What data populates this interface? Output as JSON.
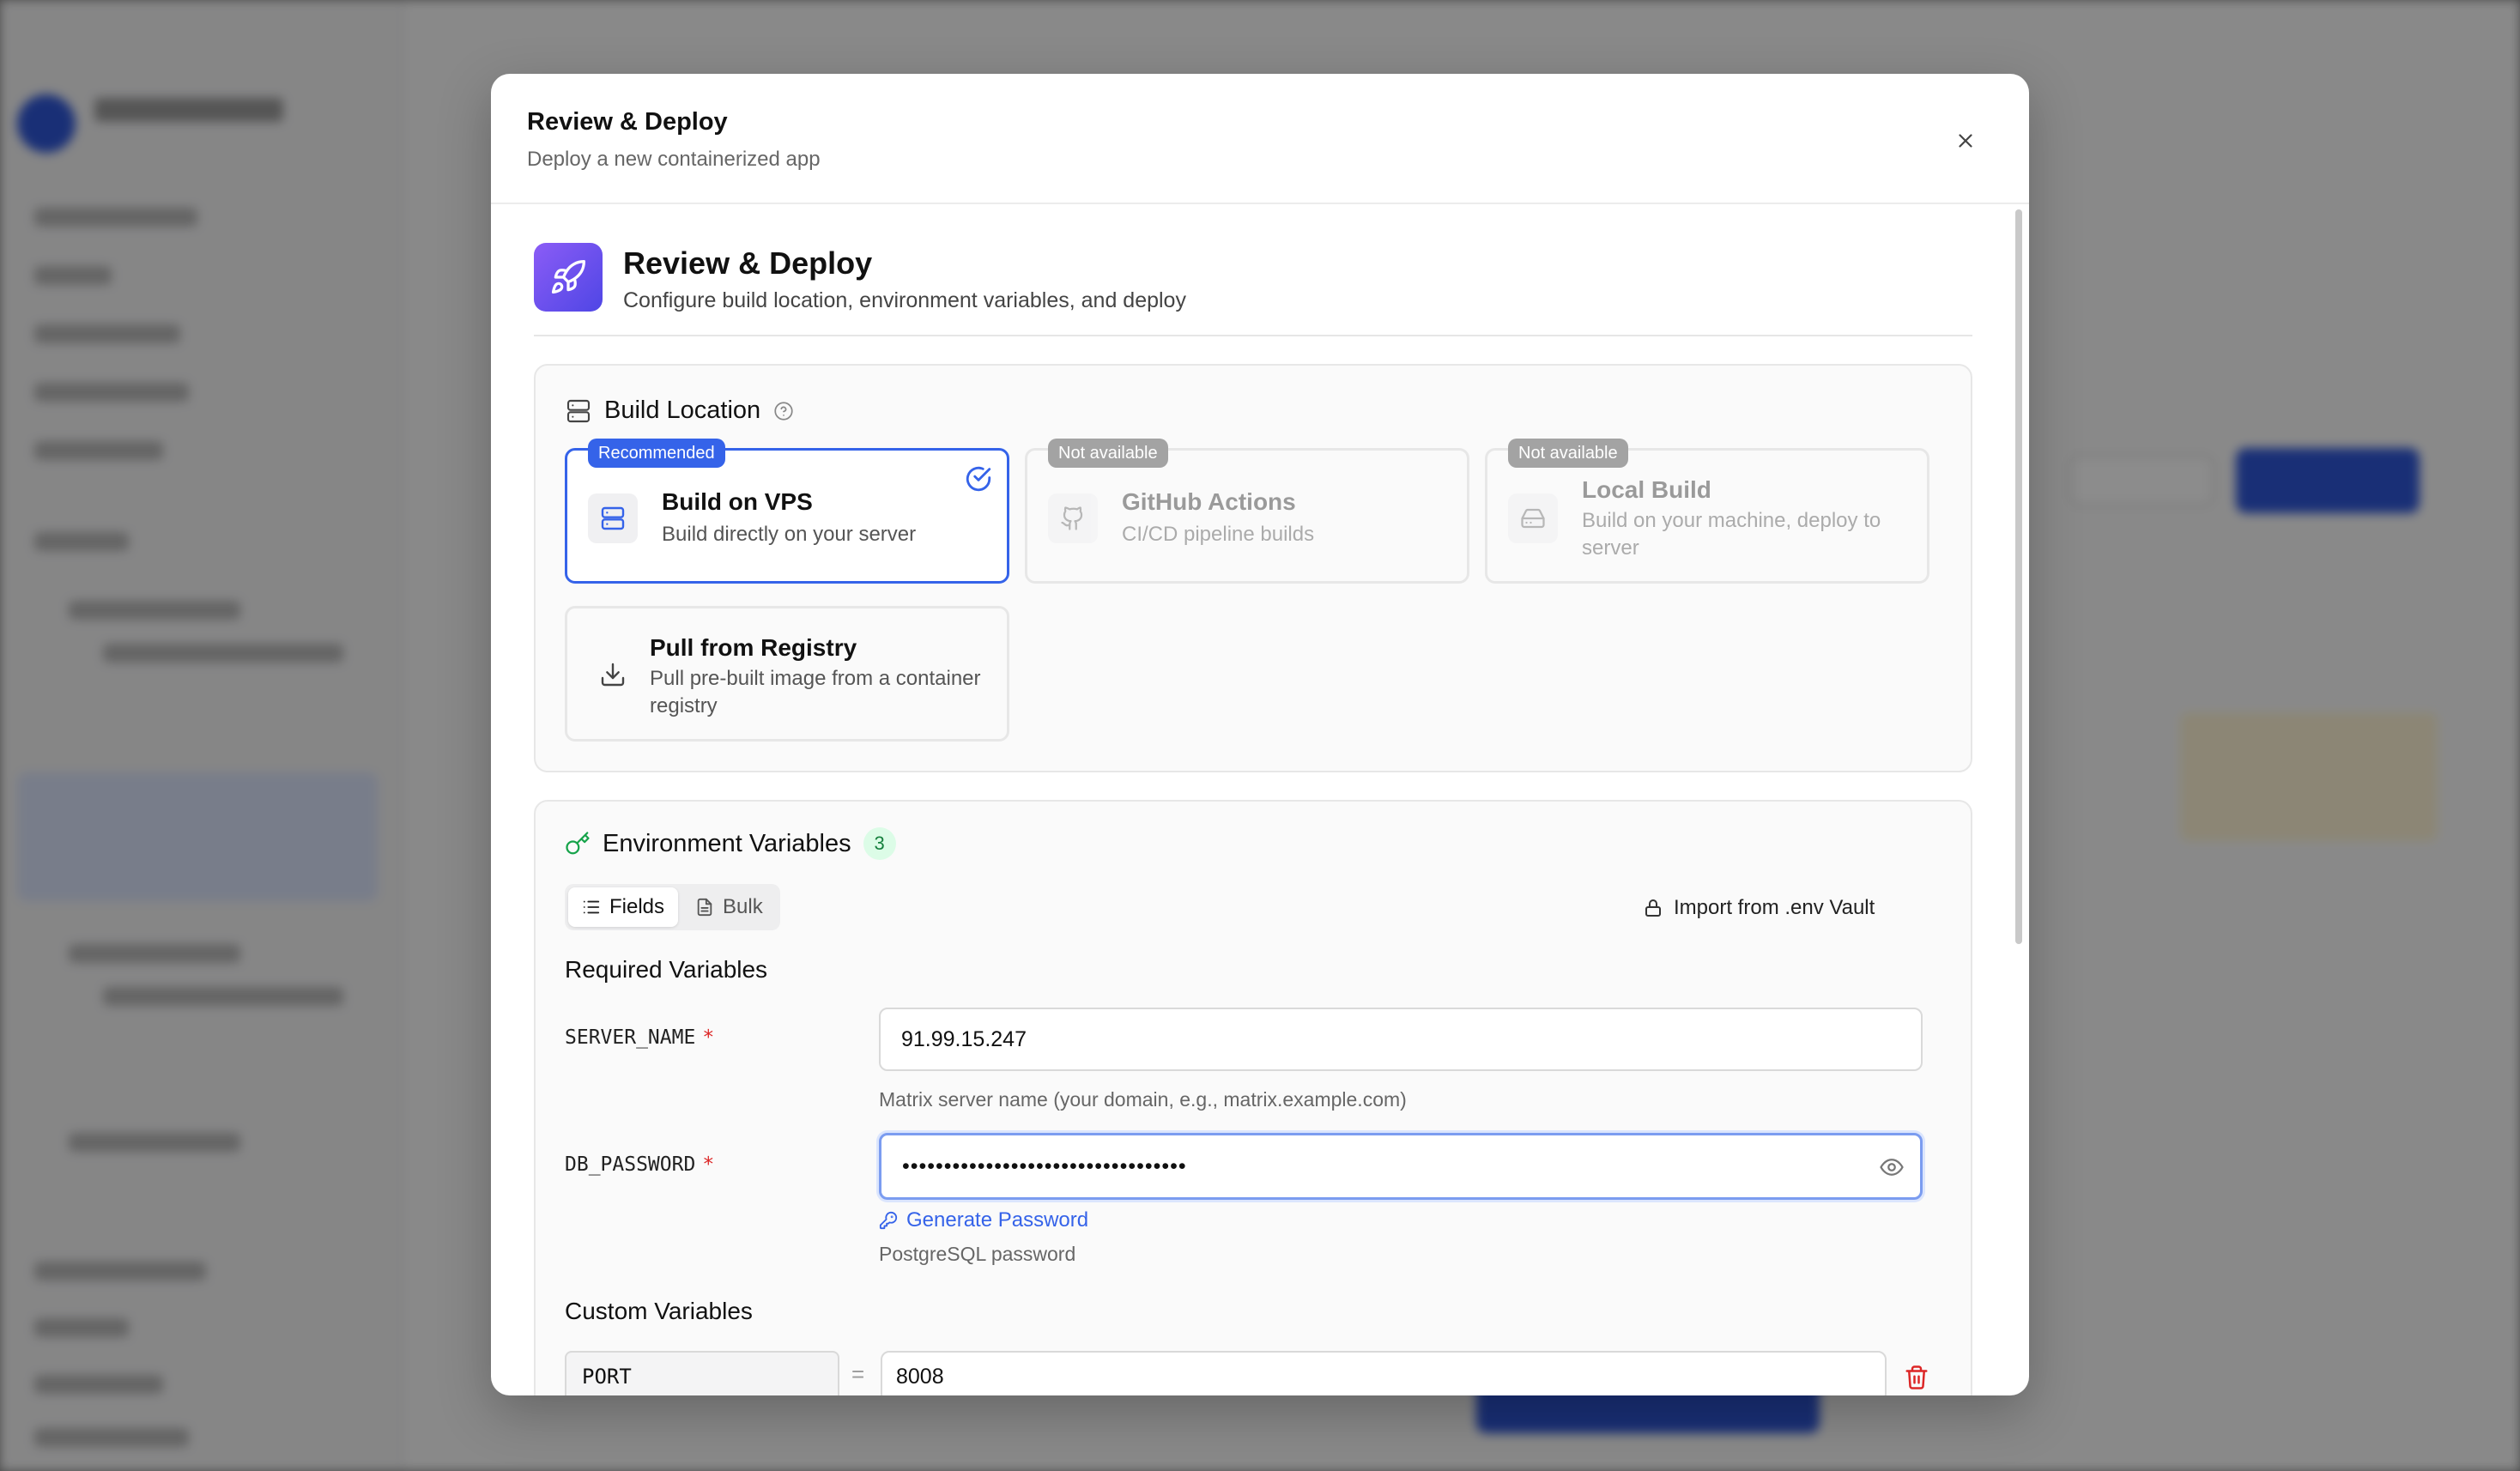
{
  "modal": {
    "title": "Review & Deploy",
    "subtitle": "Deploy a new containerized app"
  },
  "hero": {
    "title": "Review & Deploy",
    "subtitle": "Configure build location, environment variables, and deploy"
  },
  "build_location": {
    "title": "Build Location",
    "options": [
      {
        "badge": "Recommended",
        "title": "Build on VPS",
        "desc": "Build directly on your server",
        "state": "selected",
        "icon": "server-icon"
      },
      {
        "badge": "Not available",
        "title": "GitHub Actions",
        "desc": "CI/CD pipeline builds",
        "state": "disabled",
        "icon": "github-icon"
      },
      {
        "badge": "Not available",
        "title": "Local Build",
        "desc": "Build on your machine, deploy to server",
        "state": "disabled",
        "icon": "hard-drive-icon"
      },
      {
        "badge": "",
        "title": "Pull from Registry",
        "desc": "Pull pre-built image from a container registry",
        "state": "default",
        "icon": "download-icon"
      }
    ]
  },
  "env": {
    "title": "Environment Variables",
    "count": "3",
    "tabs": [
      "Fields",
      "Bulk"
    ],
    "active_tab": "Fields",
    "import_label": "Import from .env Vault",
    "required_heading": "Required Variables",
    "server_name": {
      "label": "SERVER_NAME",
      "required": "*",
      "value": "91.99.15.247",
      "hint": "Matrix server name (your domain, e.g., matrix.example.com)"
    },
    "db_password": {
      "label": "DB_PASSWORD",
      "required": "*",
      "value": "••••••••••••••••••••••••••••••••••",
      "generate_label": "Generate Password",
      "hint": "PostgreSQL password"
    },
    "custom_heading": "Custom Variables",
    "custom": [
      {
        "key": "PORT",
        "equals": "=",
        "value": "8008"
      }
    ]
  },
  "colors": {
    "accent": "#3563e9",
    "danger": "#dc2626",
    "success": "#15803d"
  }
}
